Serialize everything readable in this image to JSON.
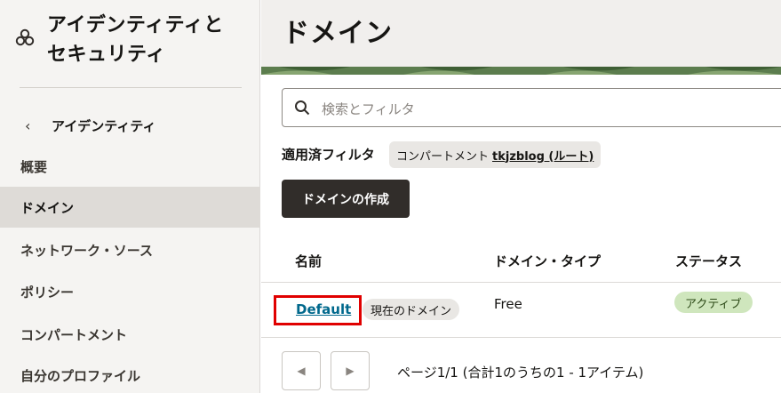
{
  "sidebar": {
    "title_line1": "アイデンティティと",
    "title_line2": "セキュリティ",
    "back_label": "アイデンティティ",
    "items": [
      {
        "label": "概要"
      },
      {
        "label": "ドメイン",
        "active": true
      },
      {
        "label": "ネットワーク・ソース"
      },
      {
        "label": "ポリシー"
      },
      {
        "label": "コンパートメント"
      },
      {
        "label": "自分のプロファイル"
      }
    ]
  },
  "main": {
    "title": "ドメイン",
    "search_placeholder": "検索とフィルタ",
    "filter_label": "適用済フィルタ",
    "filter_chip_prefix": "コンパートメント",
    "filter_chip_value": "tkjzblog (ルート)",
    "create_button": "ドメインの作成",
    "table": {
      "headers": [
        "名前",
        "ドメイン・タイプ",
        "ステータス"
      ],
      "rows": [
        {
          "name": "Default",
          "badge": "現在のドメイン",
          "type": "Free",
          "status": "アクティブ"
        }
      ]
    },
    "pagination": {
      "prev": "◀",
      "next": "▶",
      "text": "ページ1/1 (合計1のうちの1 - 1アイテム)"
    }
  },
  "colors": {
    "primary_button": "#312d2a",
    "link": "#00688c",
    "status_active_bg": "#cfe6bd",
    "highlight_box": "#e00000"
  }
}
